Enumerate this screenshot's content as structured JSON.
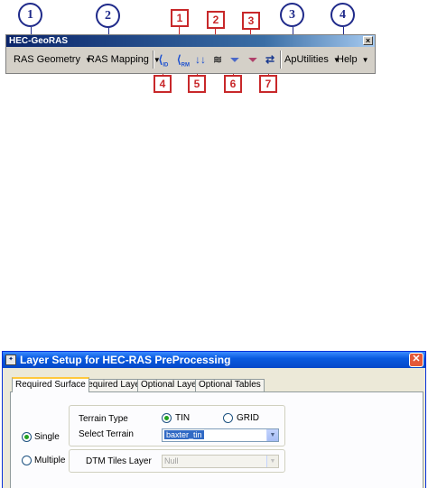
{
  "callouts": {
    "circles": [
      "1",
      "2",
      "3",
      "4"
    ],
    "top_boxes": [
      "1",
      "2",
      "3"
    ],
    "bottom_boxes": [
      "4",
      "5",
      "6",
      "7"
    ]
  },
  "toolbar": {
    "title": "HEC-GeoRAS",
    "close_glyph": "×",
    "menus": [
      {
        "label": "RAS Geometry",
        "arrow": "▼"
      },
      {
        "label": "RAS Mapping",
        "arrow": "▼"
      },
      {
        "label": "ApUtilities",
        "arrow": "▼"
      },
      {
        "label": "Help",
        "arrow": "▼"
      }
    ],
    "tools": [
      {
        "glyph": "⟨",
        "sub": "ID",
        "icon": "assign-river-id-icon",
        "color": "#1a4fd0"
      },
      {
        "glyph": "⟨",
        "sub": "RM",
        "icon": "assign-river-station-icon",
        "color": "#1a4fd0"
      },
      {
        "glyph": "↓↓",
        "sub": "",
        "icon": "flow-direction-icon",
        "color": "#1a4fd0"
      },
      {
        "glyph": "≋",
        "sub": "",
        "icon": "cross-section-lines-icon",
        "color": "#333333"
      },
      {
        "glyph": "⏷",
        "sub": "",
        "icon": "elevation-profile-icon",
        "color": "#4a68c8"
      },
      {
        "glyph": "⏷",
        "sub": "",
        "icon": "profile-3d-icon",
        "color": "#b0406a"
      },
      {
        "glyph": "⇄",
        "sub": "",
        "icon": "refresh-icon",
        "color": "#1a3a90"
      }
    ]
  },
  "dialog": {
    "title": "Layer Setup for HEC-RAS PreProcessing",
    "app_icon_glyph": "✦",
    "close_glyph": "✕",
    "tabs": [
      "Required Surface",
      "Required Layers",
      "Optional Layers",
      "Optional Tables"
    ],
    "single_label": "Single",
    "multiple_label": "Multiple",
    "terrain_type_label": "Terrain Type",
    "tin_label": "TIN",
    "grid_label": "GRID",
    "select_terrain_label": "Select Terrain",
    "select_terrain_value": "baxter_tin",
    "dtm_tiles_label": "DTM Tiles Layer",
    "dtm_tiles_value": "Null",
    "combo_arrow": "▼"
  }
}
